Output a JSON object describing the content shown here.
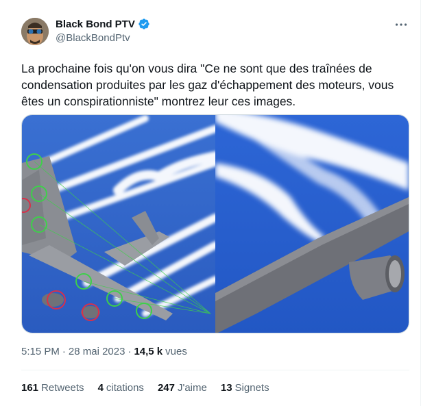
{
  "author": {
    "display_name": "Black Bond PTV",
    "handle": "@BlackBondPtv",
    "verified_color": "#1d9bf0"
  },
  "tweet": {
    "text": "La prochaine fois qu'on vous dira \"Ce ne sont que des traînées de condensation produites par les gaz d'échappement des moteurs, vous êtes un conspirationniste\" montrez leur ces images."
  },
  "meta": {
    "time": "5:15 PM",
    "separator": "·",
    "date": "28 mai 2023",
    "separator2": "·",
    "views_count": "14,5 k",
    "views_label": "vues"
  },
  "stats": {
    "retweets_count": "161",
    "retweets_label": "Retweets",
    "quotes_count": "4",
    "quotes_label": "citations",
    "likes_count": "247",
    "likes_label": "J'aime",
    "bookmarks_count": "13",
    "bookmarks_label": "Signets"
  },
  "colors": {
    "sky": "#2f63c9",
    "trail": "#ffffff",
    "circle_green": "#3ed04a",
    "circle_red": "#d8304a",
    "secondary_text": "#536471"
  },
  "icons": {
    "verified": "verified-badge-icon",
    "more": "more-options-icon"
  }
}
